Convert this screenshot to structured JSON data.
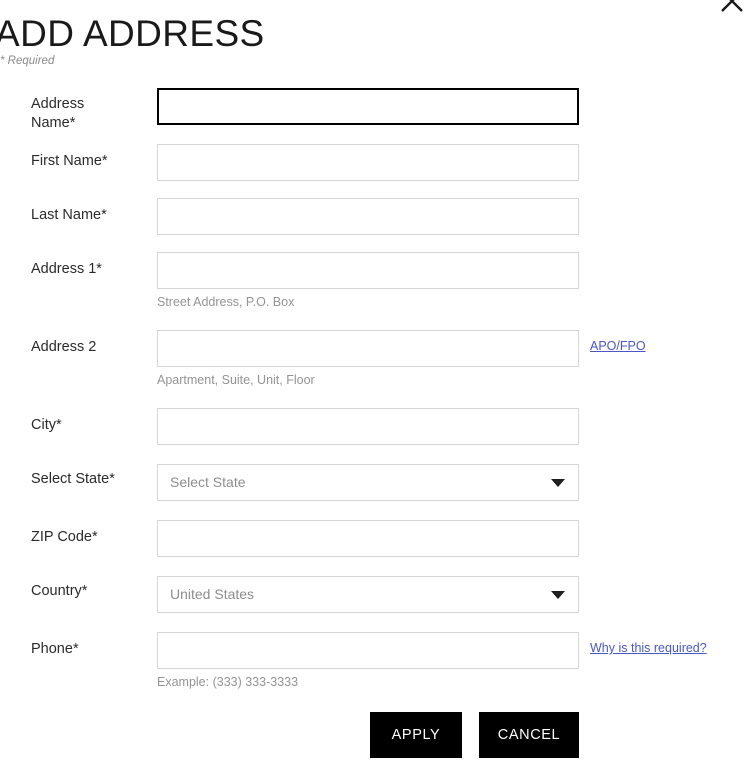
{
  "dialog": {
    "title": "ADD ADDRESS",
    "required_note": "* Required",
    "close_icon": "close-icon"
  },
  "form": {
    "required_marker": "*",
    "fields": [
      {
        "id": "address-name",
        "label": "Address",
        "label_line2": "Name",
        "required": true,
        "type": "text",
        "value": "",
        "placeholder": "",
        "focused": true,
        "helper": "",
        "side_link": ""
      },
      {
        "id": "first-name",
        "label": "First Name",
        "required": true,
        "type": "text",
        "value": "",
        "placeholder": "",
        "focused": false,
        "helper": "",
        "side_link": ""
      },
      {
        "id": "last-name",
        "label": "Last Name",
        "required": true,
        "type": "text",
        "value": "",
        "placeholder": "",
        "focused": false,
        "helper": "",
        "side_link": ""
      },
      {
        "id": "address-1",
        "label": "Address 1",
        "required": true,
        "type": "text",
        "value": "",
        "placeholder": "",
        "focused": false,
        "helper": "Street Address, P.O. Box",
        "side_link": ""
      },
      {
        "id": "address-2",
        "label": "Address 2",
        "required": false,
        "type": "text",
        "value": "",
        "placeholder": "",
        "focused": false,
        "helper": "Apartment, Suite, Unit, Floor",
        "side_link": "APO/FPO"
      },
      {
        "id": "city",
        "label": "City",
        "required": true,
        "type": "text",
        "value": "",
        "placeholder": "",
        "focused": false,
        "helper": "",
        "side_link": ""
      },
      {
        "id": "select-state",
        "label": "Select State",
        "required": true,
        "type": "select",
        "value": "Select State",
        "focused": false,
        "helper": "",
        "side_link": ""
      },
      {
        "id": "zip-code",
        "label": "ZIP Code",
        "required": true,
        "type": "text",
        "value": "",
        "placeholder": "",
        "focused": false,
        "helper": "",
        "side_link": ""
      },
      {
        "id": "country",
        "label": "Country",
        "required": true,
        "type": "select",
        "value": "United States",
        "focused": false,
        "helper": "",
        "side_link": ""
      },
      {
        "id": "phone",
        "label": "Phone",
        "required": true,
        "type": "text",
        "value": "",
        "placeholder": "",
        "focused": false,
        "helper": "Example: (333) 333-3333",
        "side_link": "Why is this required?"
      }
    ]
  },
  "actions": {
    "apply_label": "APPLY",
    "cancel_label": "CANCEL"
  },
  "colors": {
    "button_bg": "#000000",
    "button_text": "#ffffff",
    "link": "#4a57c4",
    "input_border": "#d6d6d6",
    "focused_border": "#000000",
    "helper_text": "#949494",
    "label_text": "#2b2b2b",
    "placeholder_text": "#8e8e8e"
  }
}
